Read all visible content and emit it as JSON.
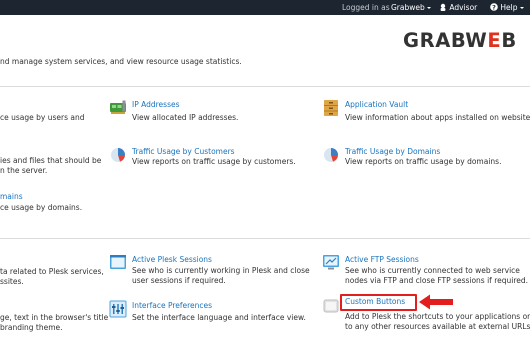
{
  "topbar": {
    "logged_in_label": "Logged in as",
    "user_name": "Grabweb",
    "advisor_label": "Advisor",
    "help_label": "Help"
  },
  "brand": {
    "logo_main": "GRABW",
    "logo_accent": "E",
    "logo_end": "B"
  },
  "intro_text": "nd manage system services, and view resource usage statistics.",
  "left_partial": {
    "row1_line1": "ce usage by users and",
    "row2_line1": "ies and files that should be",
    "row2_line2": "n the server.",
    "row3_link": "mains",
    "row3_line1": "ce usage by domains.",
    "row4_line1": "ta related to Plesk services,",
    "row4_line2": "ssites.",
    "row5_line1": "ge, text in the browser's title",
    "row5_line2": "branding theme."
  },
  "items": {
    "ip_addresses": {
      "title": "IP Addresses",
      "desc": "View allocated IP addresses."
    },
    "application_vault": {
      "title": "Application Vault",
      "desc": "View information about apps installed on websites."
    },
    "traffic_customers": {
      "title": "Traffic Usage by Customers",
      "desc": "View reports on traffic usage by customers."
    },
    "traffic_domains": {
      "title": "Traffic Usage by Domains",
      "desc": "View reports on traffic usage by domains."
    },
    "active_plesk": {
      "title": "Active Plesk Sessions",
      "desc1": "See who is currently working in Plesk and close",
      "desc2": "user sessions if required."
    },
    "active_ftp": {
      "title": "Active FTP Sessions",
      "desc1": "See who is currently connected to web service",
      "desc2": "nodes via FTP and close FTP sessions if required."
    },
    "interface_prefs": {
      "title": "Interface Preferences",
      "desc": "Set the interface language and interface view."
    },
    "custom_buttons": {
      "title": "Custom Buttons",
      "desc1": "Add to Plesk the shortcuts to your applications or",
      "desc2": "to any other resources available at external URLs."
    }
  },
  "colors": {
    "link": "#1a74bf",
    "accent": "#e0301e",
    "highlight": "#e21e1e",
    "topbar": "#1d2530"
  }
}
